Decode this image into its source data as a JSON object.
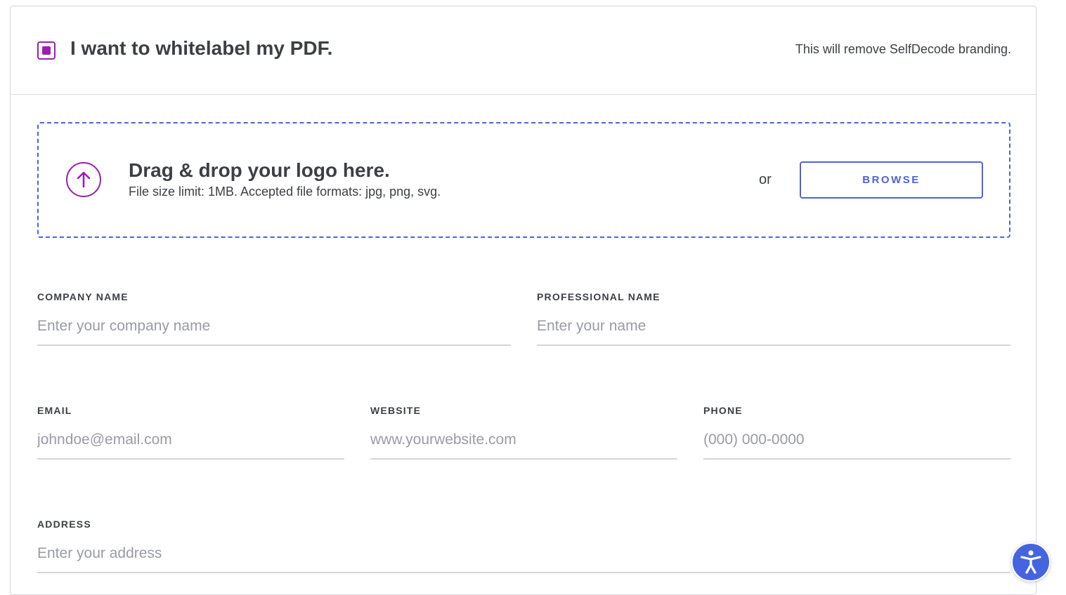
{
  "header": {
    "checkbox_checked": true,
    "title": "I want to whitelabel my PDF.",
    "note": "This will remove SelfDecode branding."
  },
  "dropzone": {
    "icon": "arrow-up-circle-icon",
    "title": "Drag & drop your logo here.",
    "subtitle": "File size limit: 1MB. Accepted file formats: jpg, png, svg.",
    "or_text": "or",
    "browse_label": "BROWSE"
  },
  "form": {
    "company_name": {
      "label": "COMPANY NAME",
      "value": "",
      "placeholder": "Enter your company name"
    },
    "professional_name": {
      "label": "PROFESSIONAL NAME",
      "value": "",
      "placeholder": "Enter your name"
    },
    "email": {
      "label": "EMAIL",
      "value": "",
      "placeholder": "johndoe@email.com"
    },
    "website": {
      "label": "WEBSITE",
      "value": "",
      "placeholder": "www.yourwebsite.com"
    },
    "phone": {
      "label": "PHONE",
      "value": "",
      "placeholder": "(000) 000-0000"
    },
    "address": {
      "label": "ADDRESS",
      "value": "",
      "placeholder": "Enter your address"
    }
  },
  "accessibility_button": {
    "icon": "accessibility-icon"
  },
  "colors": {
    "accent_purple": "#9b1fb0",
    "accent_blue": "#4f63d6",
    "text": "#3d3f45",
    "placeholder": "#9a9ba5",
    "a11y_blue": "#4565e0"
  }
}
